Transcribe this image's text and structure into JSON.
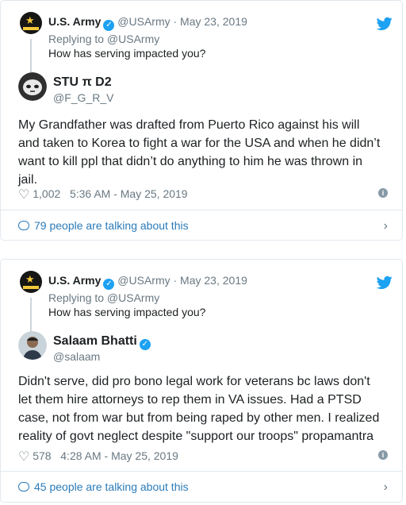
{
  "tweets": [
    {
      "parent": {
        "name": "U.S. Army",
        "handle": "@USArmy",
        "date": "· May 23, 2019",
        "replying": "Replying to @USArmy",
        "text": "How has serving impacted you?"
      },
      "author": {
        "name": "STU π D2",
        "handle": "@F_G_R_V"
      },
      "lines": [
        "My Grandfather was drafted from Puerto Rico against his will",
        "and taken to Korea to fight a war for the USA and when he didn’t",
        "want to kill ppl that didn’t do anything to him he was thrown in",
        "jail."
      ],
      "likes": "1,002",
      "time": "5:36 AM - May 25, 2019",
      "talking": "79 people are talking about this"
    },
    {
      "parent": {
        "name": "U.S. Army",
        "handle": "@USArmy",
        "date": "· May 23, 2019",
        "replying": "Replying to @USArmy",
        "text": "How has serving impacted you?"
      },
      "author": {
        "name": "Salaam Bhatti",
        "handle": "@salaam"
      },
      "lines": [
        "Didn't serve, did pro bono legal work for veterans bc laws don't",
        "let them hire attorneys to rep them in VA issues. Had a PTSD",
        "case, not from war but from being raped by other men. I realized",
        "reality of govt neglect despite \"support our troops\" propamantra"
      ],
      "likes": "578",
      "time": "4:28 AM - May 25, 2019",
      "talking": "45 people are talking about this"
    }
  ],
  "colors": {
    "link": "#2b7bb9",
    "verified": "#1da1f2",
    "muted": "#697882",
    "border": "#e1e8ed"
  },
  "icons": [
    "army-logo-icon",
    "verified-badge-icon",
    "twitter-bird-icon",
    "heart-icon",
    "info-icon",
    "speech-bubble-icon",
    "chevron-right-icon"
  ]
}
